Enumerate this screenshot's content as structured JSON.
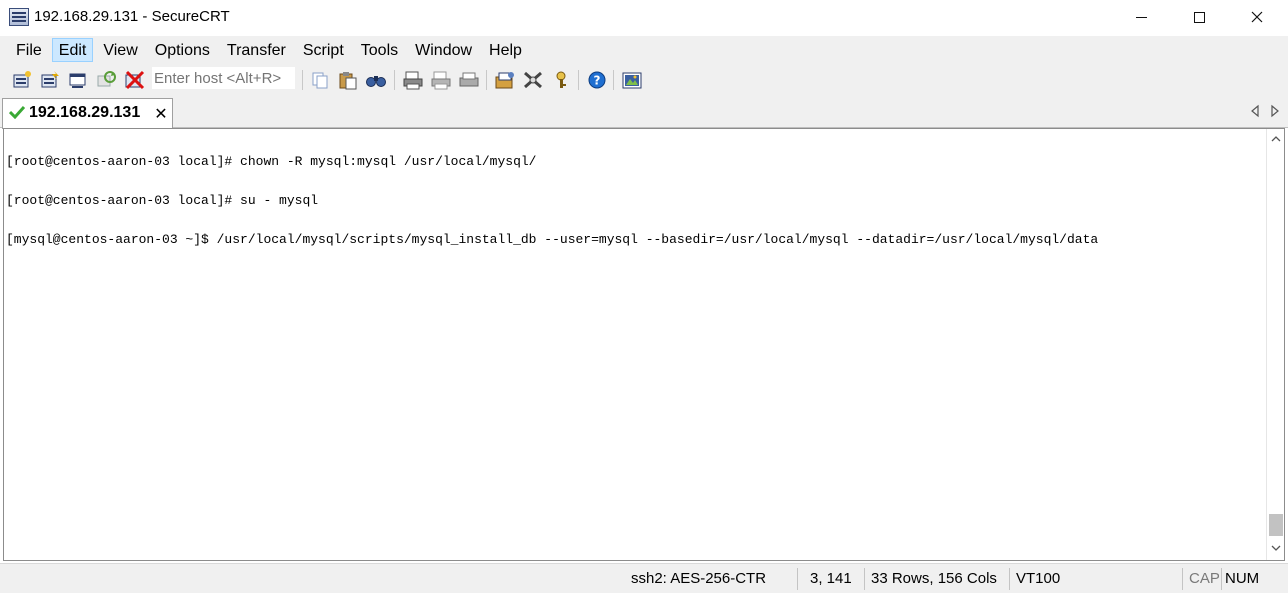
{
  "window": {
    "title": "192.168.29.131 - SecureCRT",
    "icon": "securecrt-app-icon"
  },
  "menu": [
    {
      "label": "File"
    },
    {
      "label": "Edit"
    },
    {
      "label": "View"
    },
    {
      "label": "Options"
    },
    {
      "label": "Transfer"
    },
    {
      "label": "Script"
    },
    {
      "label": "Tools"
    },
    {
      "label": "Window"
    },
    {
      "label": "Help"
    }
  ],
  "toolbar": {
    "host_placeholder": "Enter host <Alt+R>",
    "icons": [
      "connect-icon",
      "quick-connect-icon",
      "connect-tab-icon",
      "reconnect-icon",
      "disconnect-icon",
      "copy-icon",
      "paste-icon",
      "find-icon",
      "print-icon",
      "print-selection-icon",
      "print-setup-icon",
      "session-options-icon",
      "global-options-icon",
      "keymap-icon",
      "help-icon",
      "about-icon"
    ]
  },
  "tab": {
    "label": "192.168.29.131",
    "status": "connected",
    "close_glyph": "✕"
  },
  "terminal": {
    "lines": [
      "[root@centos-aaron-03 local]# chown -R mysql:mysql /usr/local/mysql/",
      "[root@centos-aaron-03 local]# su - mysql",
      "[mysql@centos-aaron-03 ~]$ /usr/local/mysql/scripts/mysql_install_db --user=mysql --basedir=/usr/local/mysql --datadir=/usr/local/mysql/data"
    ]
  },
  "status": {
    "cipher": "ssh2: AES-256-CTR",
    "cursor": "3, 141",
    "size": "33 Rows, 156 Cols",
    "emulation": "VT100",
    "cap": "CAP",
    "num": "NUM"
  },
  "colors": {
    "accent": "#cce8ff",
    "check_green": "#3aa935",
    "help_blue": "#1f6fd1"
  }
}
